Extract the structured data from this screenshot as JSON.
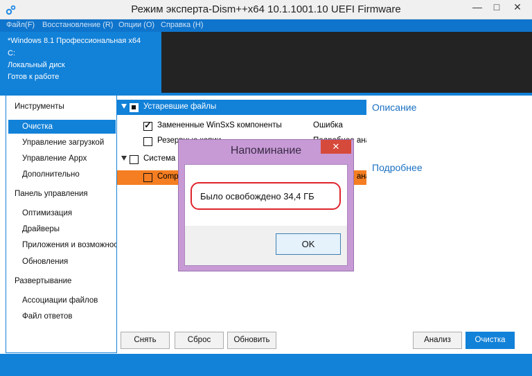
{
  "window": {
    "title": "Режим эксперта-Dism++x64 10.1.1001.10 UEFI Firmware",
    "minimize": "—",
    "maximize": "□",
    "close": "✕"
  },
  "menu": [
    "Файл(F)",
    "Восстановление (R)",
    "Опции (O)",
    "Справка (H)"
  ],
  "info": {
    "os": "*Windows 8.1 Профессиональная x64",
    "drive": "C:",
    "disk": "Локальный диск",
    "status": "Готов к работе"
  },
  "sidebar": {
    "sections": [
      {
        "label": "Инструменты",
        "items": [
          "Очистка",
          "Управление загрузкой",
          "Управление Appx",
          "Дополнительно"
        ]
      },
      {
        "label": "Панель управления",
        "items": [
          "Оптимизация",
          "Драйверы",
          "Приложения и возможности",
          "Обновления"
        ]
      },
      {
        "label": "Развертывание",
        "items": [
          "Ассоциации файлов",
          "Файл ответов"
        ]
      }
    ],
    "active": "Очистка"
  },
  "tree": {
    "groups": [
      {
        "label": "Устаревшие файлы",
        "items": [
          {
            "label": "Замененные WinSxS компоненты",
            "status": "Ошибка",
            "checked": true
          },
          {
            "label": "Резервные копии",
            "status": "Подробнее анализ",
            "checked": false
          }
        ]
      },
      {
        "label": "Система",
        "items": [
          {
            "label": "Compact",
            "status": "Подробнее анализ",
            "checked": false
          }
        ]
      }
    ]
  },
  "right_panel": {
    "description": "Описание",
    "more": "Подробнее"
  },
  "buttons": {
    "remove": "Снять",
    "reset": "Сброс",
    "refresh": "Обновить",
    "analyze": "Анализ",
    "clean": "Очистка"
  },
  "dialog": {
    "title": "Напоминание",
    "close": "✕",
    "message": "Было освобождено 34,4 ГБ",
    "ok": "OK"
  },
  "colors": {
    "accent": "#1281d8",
    "dialog_frame": "#c79ad6",
    "highlight_row": "#f57e22",
    "close_red": "#d64a3b"
  }
}
